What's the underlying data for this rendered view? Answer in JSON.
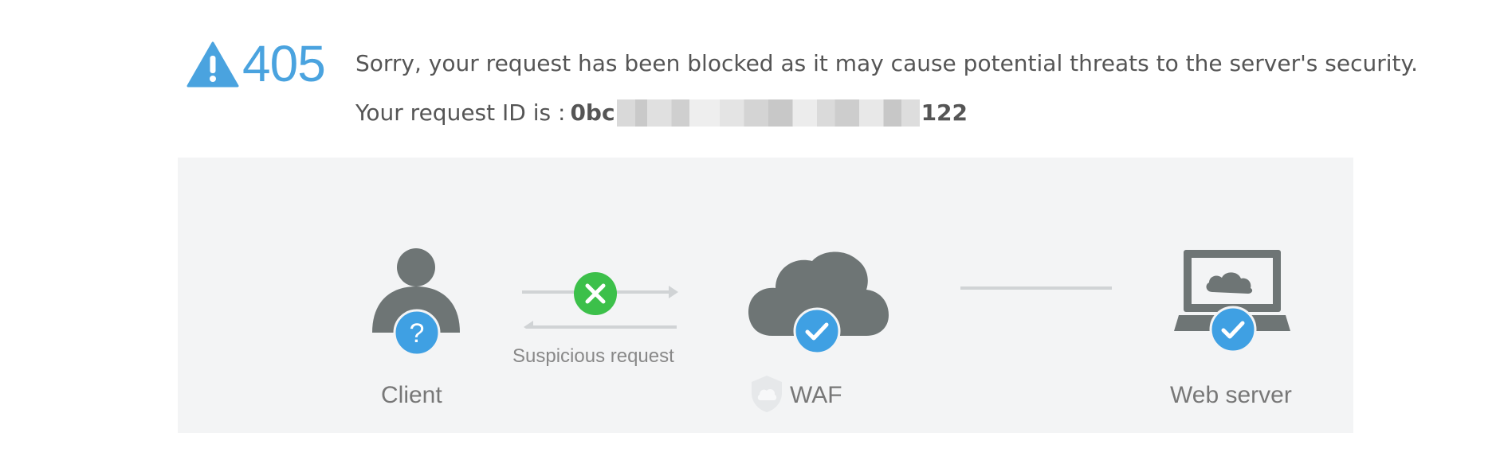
{
  "error": {
    "code": "405",
    "message": "Sorry, your request has been blocked as it may cause potential threats to the server's security.",
    "request_id_label": "Your request ID is :",
    "request_id_prefix": "0bc",
    "request_id_suffix": "122"
  },
  "diagram": {
    "client_label": "Client",
    "arrow_label": "Suspicious request",
    "waf_label": "WAF",
    "server_label": "Web server"
  },
  "colors": {
    "accent_blue": "#4aa3df",
    "icon_gray": "#6e7575",
    "block_green": "#3cc04a",
    "badge_blue": "#3fa0e3",
    "diagram_bg": "#f3f4f5"
  },
  "icons": {
    "warning": "warning-triangle-icon",
    "client": "user-icon",
    "client_badge": "question-icon",
    "block": "close-circle-icon",
    "waf": "cloud-icon",
    "waf_badge": "checkmark-icon",
    "waf_shield": "shield-icon",
    "server": "laptop-icon",
    "server_badge": "checkmark-icon"
  }
}
